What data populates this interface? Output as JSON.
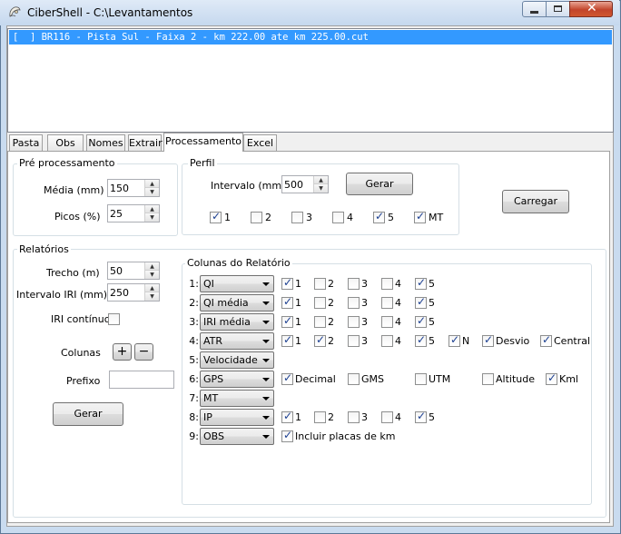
{
  "window": {
    "title": "CiberShell - C:\\Levantamentos"
  },
  "filelist": {
    "items": [
      "[  ] BR116 - Pista Sul - Faixa 2 - km 222.00 ate km 225.00.cut"
    ]
  },
  "tabs": [
    "Pasta",
    "Obs",
    "Nomes",
    "Extrair",
    "Processamento",
    "Excel"
  ],
  "preproc": {
    "title": "Pré processamento",
    "media_label": "Média (mm)",
    "media_value": "150",
    "picos_label": "Picos (%)",
    "picos_value": "25"
  },
  "perfil": {
    "title": "Perfil",
    "intervalo_label": "Intervalo (mm)",
    "intervalo_value": "500",
    "gerar_label": "Gerar",
    "checks": [
      {
        "label": "1",
        "checked": true
      },
      {
        "label": "2",
        "checked": false
      },
      {
        "label": "3",
        "checked": false
      },
      {
        "label": "4",
        "checked": false
      },
      {
        "label": "5",
        "checked": true
      },
      {
        "label": "MT",
        "checked": true
      }
    ]
  },
  "carregar_label": "Carregar",
  "relatorios": {
    "title": "Relatórios",
    "trecho_label": "Trecho (m)",
    "trecho_value": "50",
    "iri_label": "Intervalo IRI (mm)",
    "iri_value": "250",
    "iri_continuo_label": "IRI contínuo",
    "iri_continuo_checked": false,
    "colunas_label": "Colunas",
    "plus": "+",
    "minus": "−",
    "prefixo_label": "Prefixo",
    "prefixo_value": "",
    "gerar_label": "Gerar"
  },
  "colunas": {
    "title": "Colunas do Relatório",
    "rows": [
      {
        "num": "1:",
        "value": "QI",
        "checks": [
          {
            "label": "1",
            "checked": true
          },
          {
            "label": "2",
            "checked": false
          },
          {
            "label": "3",
            "checked": false
          },
          {
            "label": "4",
            "checked": false
          },
          {
            "label": "5",
            "checked": true
          }
        ]
      },
      {
        "num": "2:",
        "value": "QI média",
        "checks": [
          {
            "label": "1",
            "checked": true
          },
          {
            "label": "2",
            "checked": false
          },
          {
            "label": "3",
            "checked": false
          },
          {
            "label": "4",
            "checked": false
          },
          {
            "label": "5",
            "checked": true
          }
        ]
      },
      {
        "num": "3:",
        "value": "IRI média",
        "checks": [
          {
            "label": "1",
            "checked": true
          },
          {
            "label": "2",
            "checked": false
          },
          {
            "label": "3",
            "checked": false
          },
          {
            "label": "4",
            "checked": false
          },
          {
            "label": "5",
            "checked": true
          }
        ]
      },
      {
        "num": "4:",
        "value": "ATR",
        "checks": [
          {
            "label": "1",
            "checked": true
          },
          {
            "label": "2",
            "checked": true
          },
          {
            "label": "3",
            "checked": false
          },
          {
            "label": "4",
            "checked": false
          },
          {
            "label": "5",
            "checked": true
          },
          {
            "label": "N",
            "checked": true
          },
          {
            "label": "Desvio",
            "checked": true
          },
          {
            "label": "Central",
            "checked": true
          }
        ]
      },
      {
        "num": "5:",
        "value": "Velocidade",
        "checks": []
      },
      {
        "num": "6:",
        "value": "GPS",
        "checks": [
          {
            "label": "Decimal",
            "checked": true
          },
          {
            "label": "GMS",
            "checked": false
          },
          {
            "label": "UTM",
            "checked": false
          },
          {
            "label": "Altitude",
            "checked": false
          },
          {
            "label": "Kml",
            "checked": true
          }
        ]
      },
      {
        "num": "7:",
        "value": "MT",
        "checks": []
      },
      {
        "num": "8:",
        "value": "IP",
        "checks": [
          {
            "label": "1",
            "checked": true
          },
          {
            "label": "2",
            "checked": false
          },
          {
            "label": "3",
            "checked": false
          },
          {
            "label": "4",
            "checked": false
          },
          {
            "label": "5",
            "checked": true
          }
        ]
      },
      {
        "num": "9:",
        "value": "OBS",
        "checks": [
          {
            "label": "Incluir placas de km",
            "checked": true
          }
        ]
      }
    ]
  },
  "icons": {
    "app": "shell-icon",
    "minimize": "minimize-icon",
    "maximize": "maximize-icon",
    "close": "close-icon"
  }
}
